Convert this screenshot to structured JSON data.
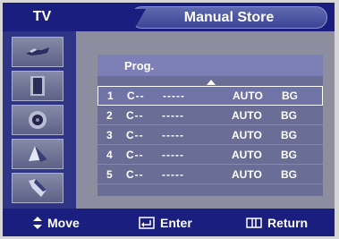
{
  "header": {
    "tv_tab": "TV",
    "title": "Manual Store"
  },
  "sidebar": {
    "items": [
      {
        "icon": "antenna-icon"
      },
      {
        "icon": "picture-icon"
      },
      {
        "icon": "speaker-icon"
      },
      {
        "icon": "channel-icon"
      },
      {
        "icon": "setup-icon"
      }
    ]
  },
  "list": {
    "header": "Prog.",
    "rows": [
      {
        "num": "1",
        "channel": "C--",
        "name": "-----",
        "mode": "AUTO",
        "system": "BG",
        "selected": true
      },
      {
        "num": "2",
        "channel": "C--",
        "name": "-----",
        "mode": "AUTO",
        "system": "BG"
      },
      {
        "num": "3",
        "channel": "C--",
        "name": "-----",
        "mode": "AUTO",
        "system": "BG"
      },
      {
        "num": "4",
        "channel": "C--",
        "name": "-----",
        "mode": "AUTO",
        "system": "BG"
      },
      {
        "num": "5",
        "channel": "C--",
        "name": "-----",
        "mode": "AUTO",
        "system": "BG"
      }
    ]
  },
  "footer": {
    "move": "Move",
    "enter": "Enter",
    "return": "Return"
  }
}
